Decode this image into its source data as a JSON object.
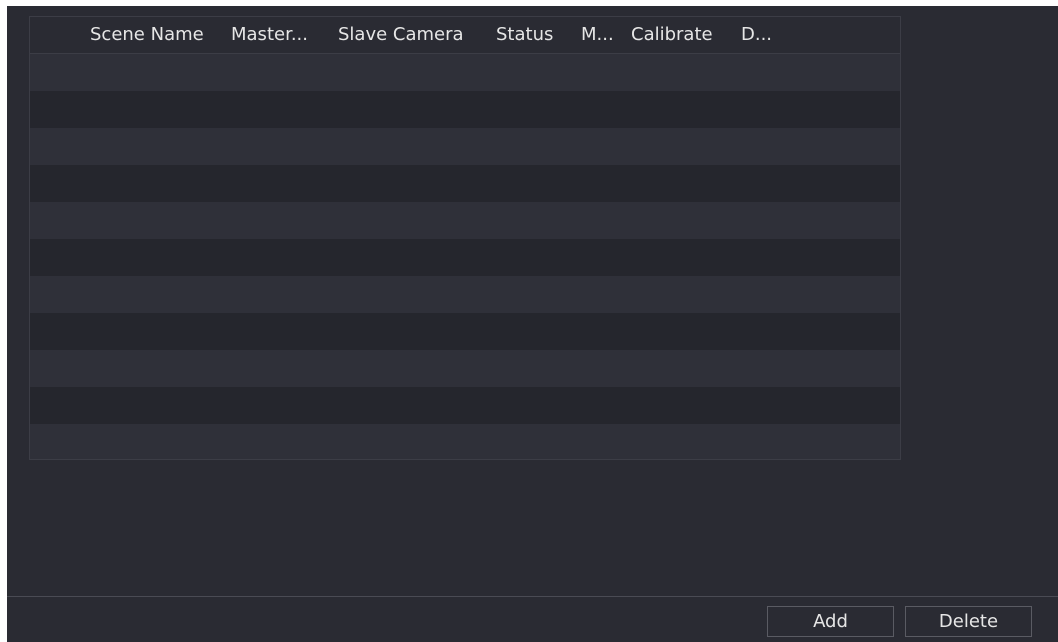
{
  "table": {
    "columns": [
      "Scene Name",
      "Master...",
      "Slave Camera",
      "Status",
      "M...",
      "Calibrate",
      "D..."
    ],
    "rows": []
  },
  "actions": {
    "add_label": "Add",
    "delete_label": "Delete"
  },
  "colors": {
    "background": "#2a2b33",
    "row_alt": "#2f3039",
    "row_dark": "#25262d",
    "border": "#3c3d46",
    "text": "#e6e6e6"
  }
}
